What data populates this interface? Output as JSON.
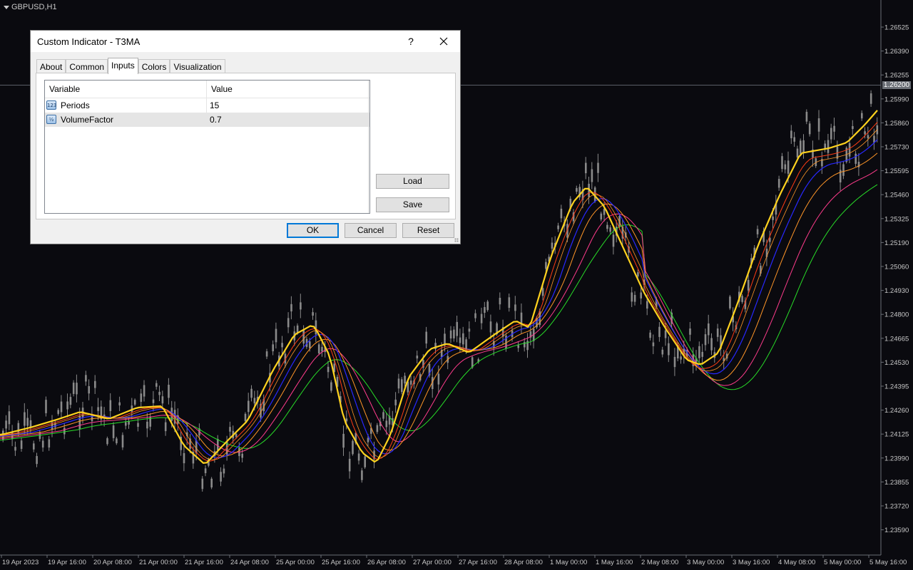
{
  "chart": {
    "symbol": "GBPUSD,H1",
    "current_price": "1.26200",
    "price_labels": [
      "1.26525",
      "1.26390",
      "1.26255",
      "1.25990",
      "1.25860",
      "1.25730",
      "1.25595",
      "1.25460",
      "1.25325",
      "1.25190",
      "1.25060",
      "1.24930",
      "1.24800",
      "1.24665",
      "1.24530",
      "1.24395",
      "1.24260",
      "1.24125",
      "1.23990",
      "1.23855",
      "1.23720",
      "1.23590"
    ],
    "time_labels": [
      "19 Apr 2023",
      "19 Apr 16:00",
      "20 Apr 08:00",
      "21 Apr 00:00",
      "21 Apr 16:00",
      "24 Apr 08:00",
      "25 Apr 00:00",
      "25 Apr 16:00",
      "26 Apr 08:00",
      "27 Apr 00:00",
      "27 Apr 16:00",
      "28 Apr 08:00",
      "1 May 00:00",
      "1 May 16:00",
      "2 May 08:00",
      "3 May 00:00",
      "3 May 16:00",
      "4 May 08:00",
      "5 May 00:00",
      "5 May 16:00"
    ],
    "colors": {
      "background": "#0a0a0f",
      "candles": "#8a8a8a",
      "t3_main": "#ffd21e",
      "ma_red": "#ff3c14",
      "ma_blue": "#2828ff",
      "ma_orange": "#ff9628",
      "ma_pink": "#ff3c8c",
      "ma_green": "#28dc28",
      "axis_text": "#c8c8c8"
    }
  },
  "dialog": {
    "title": "Custom Indicator - T3MA",
    "help_label": "?",
    "close_icon": "close-icon",
    "tabs": [
      "About",
      "Common",
      "Inputs",
      "Colors",
      "Visualization"
    ],
    "active_tab": "Inputs",
    "grid": {
      "headers": [
        "Variable",
        "Value"
      ],
      "rows": [
        {
          "icon": "123",
          "icon_name": "integer-type-icon",
          "variable": "Periods",
          "value": "15"
        },
        {
          "icon": "½",
          "icon_name": "double-type-icon",
          "variable": "VolumeFactor",
          "value": "0.7"
        }
      ]
    },
    "buttons": {
      "load": "Load",
      "save": "Save",
      "ok": "OK",
      "cancel": "Cancel",
      "reset": "Reset"
    }
  }
}
